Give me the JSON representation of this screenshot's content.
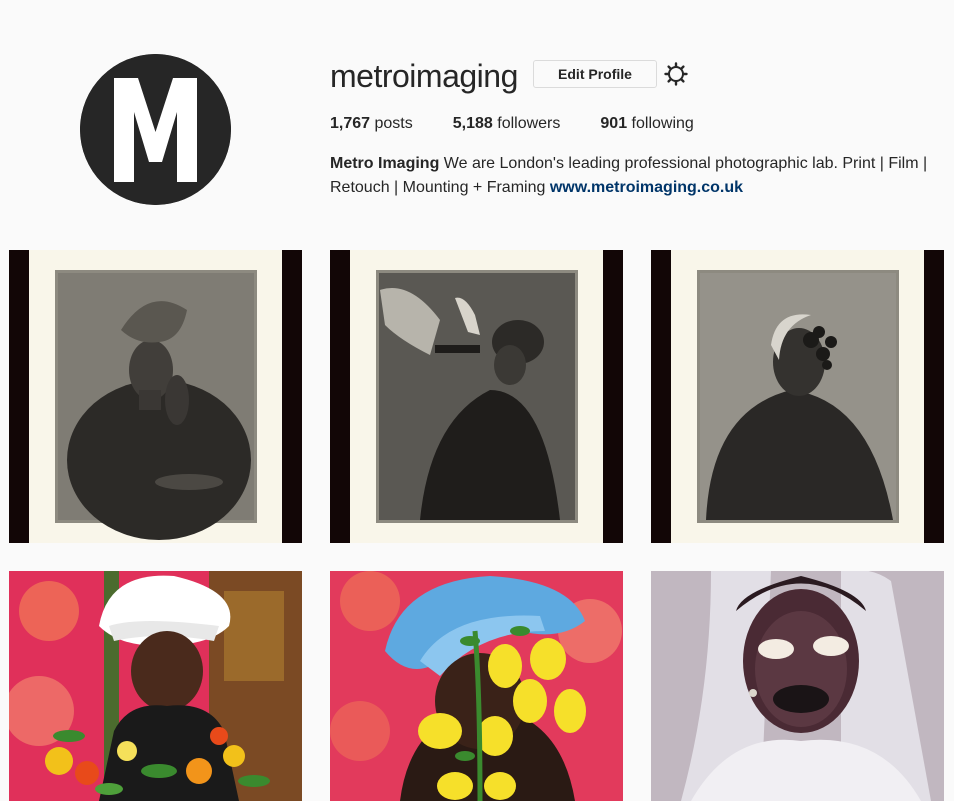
{
  "profile": {
    "avatar_letter": "M",
    "username": "metroimaging",
    "edit_profile_label": "Edit Profile",
    "stats": {
      "posts_count": "1,767",
      "posts_label": "posts",
      "followers_count": "5,188",
      "followers_label": "followers",
      "following_count": "901",
      "following_label": "following"
    },
    "bio": {
      "name": "Metro Imaging",
      "text": "We are London's leading professional photographic lab. Print | Film | Retouch | Mounting + Framing",
      "link": "www.metroimaging.co.uk"
    }
  },
  "colors": {
    "background": "#fafafa",
    "text": "#262626",
    "link": "#003569",
    "button_border": "#dbdbdb",
    "avatar": "#262626"
  },
  "posts": [
    {
      "icon": "tintype-portrait-hand-to-face"
    },
    {
      "icon": "tintype-portrait-pouring"
    },
    {
      "icon": "tintype-portrait-flowers-face"
    },
    {
      "icon": "color-portrait-white-headwrap-flowers"
    },
    {
      "icon": "color-portrait-blue-headwrap-lemons"
    },
    {
      "icon": "vintage-photo-veil-shells"
    }
  ]
}
